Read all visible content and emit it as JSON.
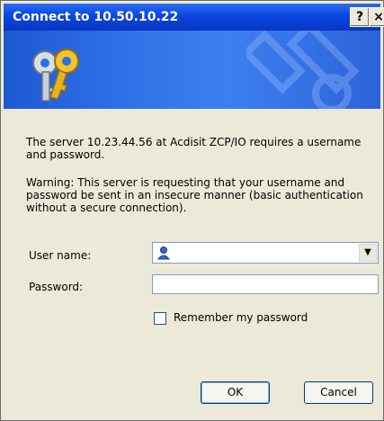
{
  "window": {
    "title": "Connect to 10.50.10.22",
    "help_label": "?",
    "close_label": "×"
  },
  "dialog": {
    "message": "The server 10.23.44.56 at Acdisit ZCP/IO requires a username and password.",
    "warning": "Warning: This server is requesting that your username and password be sent in an insecure manner (basic authentication without a secure connection).",
    "username_label": "User name:",
    "username_value": "",
    "password_label": "Password:",
    "password_value": "",
    "remember_label": "Remember my password",
    "remember_checked": false,
    "ok_label": "OK",
    "cancel_label": "Cancel"
  },
  "icons": {
    "banner": "keys-icon",
    "user": "user-icon"
  },
  "colors": {
    "titlebar": "#0b46e0",
    "banner": "#2f6fe6",
    "dialog_bg": "#ece9d8"
  }
}
